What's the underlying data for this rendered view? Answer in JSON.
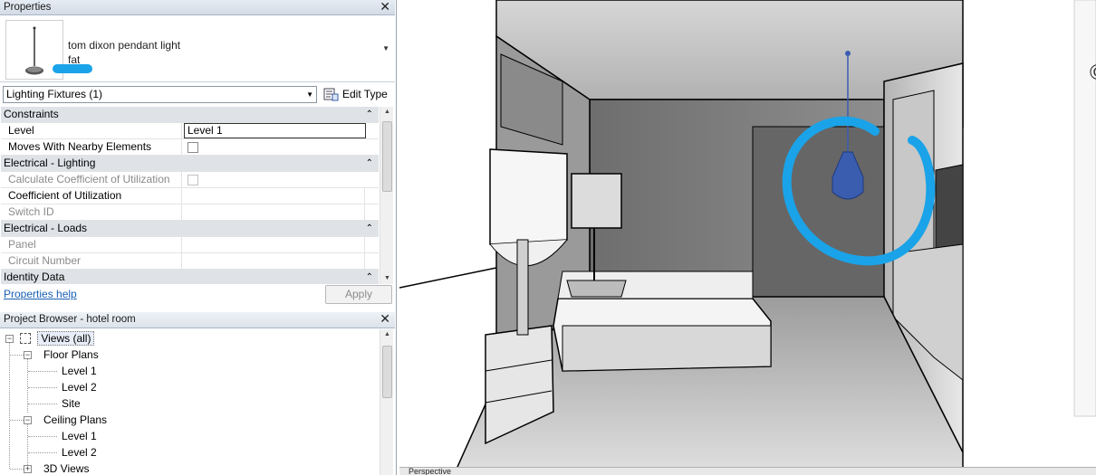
{
  "properties": {
    "title": "Properties",
    "type_name": "tom dixon pendant light",
    "type_sub": "fat",
    "filter_label": "Lighting Fixtures (1)",
    "edit_type_label": "Edit Type",
    "groups": {
      "constraints": "Constraints",
      "electrical_lighting": "Electrical - Lighting",
      "electrical_loads": "Electrical - Loads",
      "identity_data": "Identity Data"
    },
    "params": {
      "level_label": "Level",
      "level_value": "Level 1",
      "moves_label": "Moves With Nearby Elements",
      "calc_cu_label": "Calculate Coefficient of Utilization",
      "cu_label": "Coefficient of Utilization",
      "switch_label": "Switch ID",
      "panel_label": "Panel",
      "circuit_label": "Circuit Number"
    },
    "help_link": "Properties help",
    "apply_label": "Apply"
  },
  "project_browser": {
    "title": "Project Browser - hotel room",
    "views_all": "Views (all)",
    "floor_plans": "Floor Plans",
    "fp_level1": "Level 1",
    "fp_level2": "Level 2",
    "fp_site": "Site",
    "ceiling_plans": "Ceiling Plans",
    "cp_level1": "Level 1",
    "cp_level2": "Level 2",
    "views_3d": "3D Views"
  },
  "view_control_bar": {
    "view_type": "Perspective"
  },
  "colors": {
    "highlight_scribble": "#1aa3e8",
    "selected_element": "#3a5db0",
    "link": "#1a5fb4"
  }
}
